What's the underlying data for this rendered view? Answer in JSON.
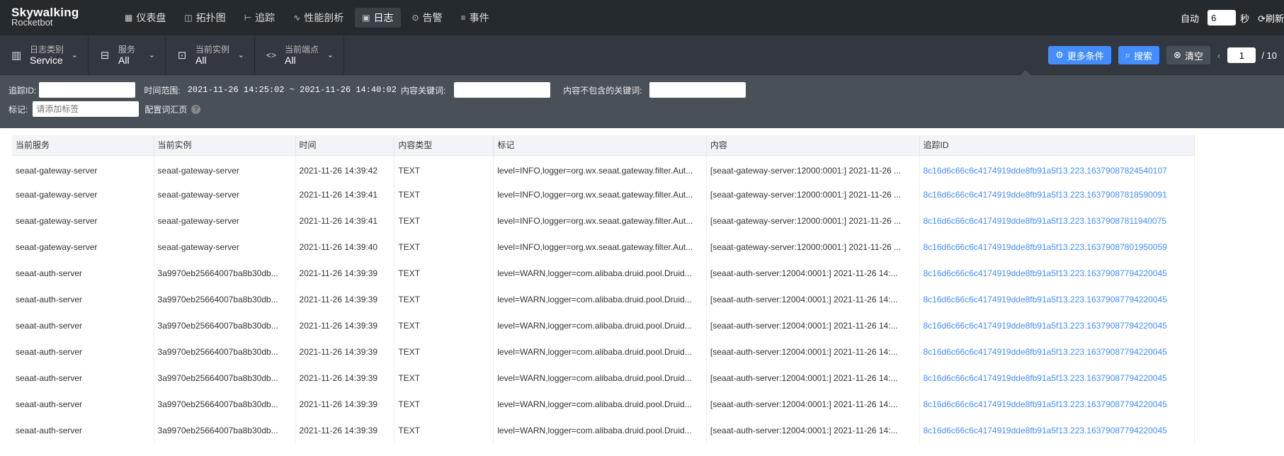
{
  "brand": {
    "line1": "Skywalking",
    "line2": "Rocketbot"
  },
  "nav": [
    {
      "icon": "▦",
      "label": "仪表盘"
    },
    {
      "icon": "◫",
      "label": "拓扑图"
    },
    {
      "icon": "⊢",
      "label": "追踪"
    },
    {
      "icon": "∿",
      "label": "性能剖析"
    },
    {
      "icon": "▣",
      "label": "日志"
    },
    {
      "icon": "⊙",
      "label": "告警"
    },
    {
      "icon": "≡",
      "label": "事件"
    }
  ],
  "autoRefresh": {
    "label": "自动",
    "value": "6",
    "unit": "秒",
    "refresh": "刷新"
  },
  "selectors": [
    {
      "icon": "▥",
      "label": "日志类别",
      "value": "Service"
    },
    {
      "icon": "⊟",
      "label": "服务",
      "value": "All"
    },
    {
      "icon": "⊡",
      "label": "当前实例",
      "value": "All"
    },
    {
      "icon": "<>",
      "label": "当前端点",
      "value": "All"
    }
  ],
  "tools": {
    "more": "更多条件",
    "search": "搜索",
    "clear": "清空",
    "page": "1",
    "total": "/ 10"
  },
  "conds": {
    "traceLabel": "追踪ID:",
    "timeLabel": "时间范围:",
    "timeValue": "2021-11-26 14:25:02 ~ 2021-11-26 14:40:02",
    "kwLabel": "内容关键词:",
    "exKwLabel": "内容不包含的关键词:",
    "tagLabel": "标记:",
    "tagPlaceholder": "请添加标签",
    "configLabel": "配置词汇页"
  },
  "table": {
    "headers": [
      "当前服务",
      "当前实例",
      "时间",
      "内容类型",
      "标记",
      "内容",
      "追踪ID"
    ],
    "rows": [
      [
        "seaat-gateway-server",
        "seaat-gateway-server",
        "2021-11-26 14:39:42",
        "TEXT",
        "level=INFO,logger=org.wx.seaat.gateway.filter.Aut...",
        "[seaat-gateway-server:12000:0001:] 2021-11-26 ...",
        "8c16d6c66c6c4174919dde8fb91a5f13.223.16379087824540107"
      ],
      [
        "seaat-gateway-server",
        "seaat-gateway-server",
        "2021-11-26 14:39:41",
        "TEXT",
        "level=INFO,logger=org.wx.seaat.gateway.filter.Aut...",
        "[seaat-gateway-server:12000:0001:] 2021-11-26 ...",
        "8c16d6c66c6c4174919dde8fb91a5f13.223.16379087818590091"
      ],
      [
        "seaat-gateway-server",
        "seaat-gateway-server",
        "2021-11-26 14:39:41",
        "TEXT",
        "level=INFO,logger=org.wx.seaat.gateway.filter.Aut...",
        "[seaat-gateway-server:12000:0001:] 2021-11-26 ...",
        "8c16d6c66c6c4174919dde8fb91a5f13.223.16379087811940075"
      ],
      [
        "seaat-gateway-server",
        "seaat-gateway-server",
        "2021-11-26 14:39:40",
        "TEXT",
        "level=INFO,logger=org.wx.seaat.gateway.filter.Aut...",
        "[seaat-gateway-server:12000:0001:] 2021-11-26 ...",
        "8c16d6c66c6c4174919dde8fb91a5f13.223.16379087801950059"
      ],
      [
        "seaat-auth-server",
        "3a9970eb25664007ba8b30db...",
        "2021-11-26 14:39:39",
        "TEXT",
        "level=WARN,logger=com.alibaba.druid.pool.Druid...",
        "[seaat-auth-server:12004:0001:] 2021-11-26 14:...",
        "8c16d6c66c6c4174919dde8fb91a5f13.223.16379087794220045"
      ],
      [
        "seaat-auth-server",
        "3a9970eb25664007ba8b30db...",
        "2021-11-26 14:39:39",
        "TEXT",
        "level=WARN,logger=com.alibaba.druid.pool.Druid...",
        "[seaat-auth-server:12004:0001:] 2021-11-26 14:...",
        "8c16d6c66c6c4174919dde8fb91a5f13.223.16379087794220045"
      ],
      [
        "seaat-auth-server",
        "3a9970eb25664007ba8b30db...",
        "2021-11-26 14:39:39",
        "TEXT",
        "level=WARN,logger=com.alibaba.druid.pool.Druid...",
        "[seaat-auth-server:12004:0001:] 2021-11-26 14:...",
        "8c16d6c66c6c4174919dde8fb91a5f13.223.16379087794220045"
      ],
      [
        "seaat-auth-server",
        "3a9970eb25664007ba8b30db...",
        "2021-11-26 14:39:39",
        "TEXT",
        "level=WARN,logger=com.alibaba.druid.pool.Druid...",
        "[seaat-auth-server:12004:0001:] 2021-11-26 14:...",
        "8c16d6c66c6c4174919dde8fb91a5f13.223.16379087794220045"
      ],
      [
        "seaat-auth-server",
        "3a9970eb25664007ba8b30db...",
        "2021-11-26 14:39:39",
        "TEXT",
        "level=WARN,logger=com.alibaba.druid.pool.Druid...",
        "[seaat-auth-server:12004:0001:] 2021-11-26 14:...",
        "8c16d6c66c6c4174919dde8fb91a5f13.223.16379087794220045"
      ],
      [
        "seaat-auth-server",
        "3a9970eb25664007ba8b30db...",
        "2021-11-26 14:39:39",
        "TEXT",
        "level=WARN,logger=com.alibaba.druid.pool.Druid...",
        "[seaat-auth-server:12004:0001:] 2021-11-26 14:...",
        "8c16d6c66c6c4174919dde8fb91a5f13.223.16379087794220045"
      ],
      [
        "seaat-auth-server",
        "3a9970eb25664007ba8b30db...",
        "2021-11-26 14:39:39",
        "TEXT",
        "level=WARN,logger=com.alibaba.druid.pool.Druid...",
        "[seaat-auth-server:12004:0001:] 2021-11-26 14:...",
        "8c16d6c66c6c4174919dde8fb91a5f13.223.16379087794220045"
      ]
    ]
  }
}
